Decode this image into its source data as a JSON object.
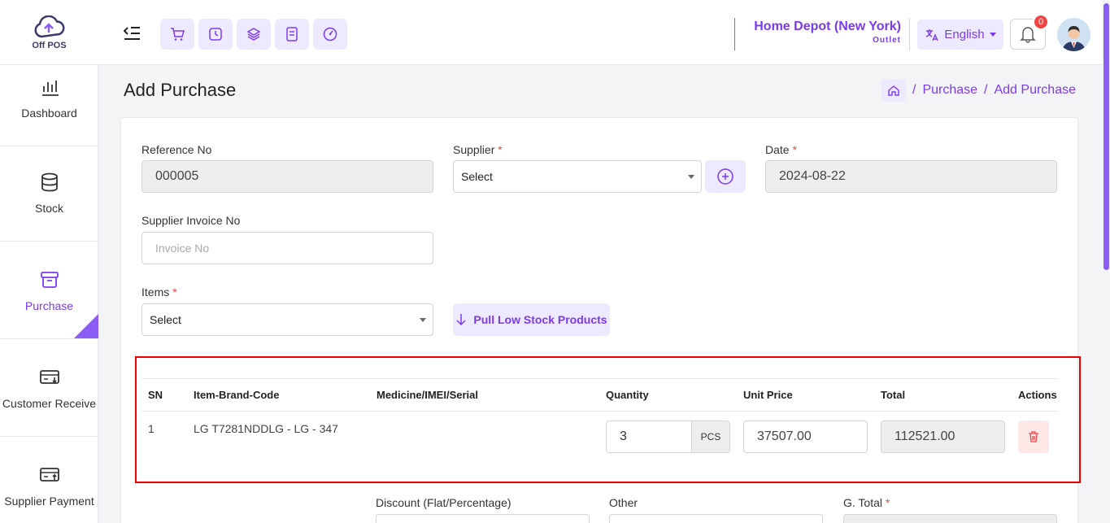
{
  "app": {
    "logo_text": "Off POS"
  },
  "header": {
    "outlet_name": "Home Depot (New York)",
    "outlet_sub": "Outlet",
    "language": "English",
    "notification_count": "0",
    "quick_actions": [
      "cart-icon",
      "clock-icon",
      "layers-icon",
      "receipt-icon",
      "dashboard-icon"
    ]
  },
  "sidebar": {
    "items": [
      {
        "label": "Dashboard",
        "icon": "bar-chart-icon"
      },
      {
        "label": "Stock",
        "icon": "database-icon"
      },
      {
        "label": "Purchase",
        "icon": "archive-icon",
        "active": true
      },
      {
        "label": "Customer Receive",
        "icon": "card-in-icon"
      },
      {
        "label": "Supplier Payment",
        "icon": "card-out-icon"
      }
    ]
  },
  "page": {
    "title": "Add Purchase",
    "breadcrumb": [
      "Purchase",
      "Add Purchase"
    ]
  },
  "form": {
    "reference_label": "Reference No",
    "reference_value": "000005",
    "supplier_label": "Supplier",
    "supplier_value": "Select",
    "date_label": "Date",
    "date_value": "2024-08-22",
    "invoice_label": "Supplier Invoice No",
    "invoice_placeholder": "Invoice No",
    "items_label": "Items",
    "items_value": "Select",
    "pull_button": "Pull Low Stock Products",
    "required_mark": "*",
    "discount_label": "Discount (Flat/Percentage)",
    "other_label": "Other",
    "gtotal_label": "G. Total"
  },
  "table": {
    "headers": [
      "SN",
      "Item-Brand-Code",
      "Medicine/IMEI/Serial",
      "Quantity",
      "Unit Price",
      "Total",
      "Actions"
    ],
    "rows": [
      {
        "sn": "1",
        "item": "LG T7281NDDLG - LG - 347",
        "serial": "",
        "quantity": "3",
        "unit": "PCS",
        "unit_price": "37507.00",
        "total": "112521.00"
      }
    ]
  },
  "colors": {
    "accent": "#7c3aed",
    "accent_light": "#ede9fe",
    "danger": "#ef4444",
    "highlight_border": "#ee0000"
  }
}
